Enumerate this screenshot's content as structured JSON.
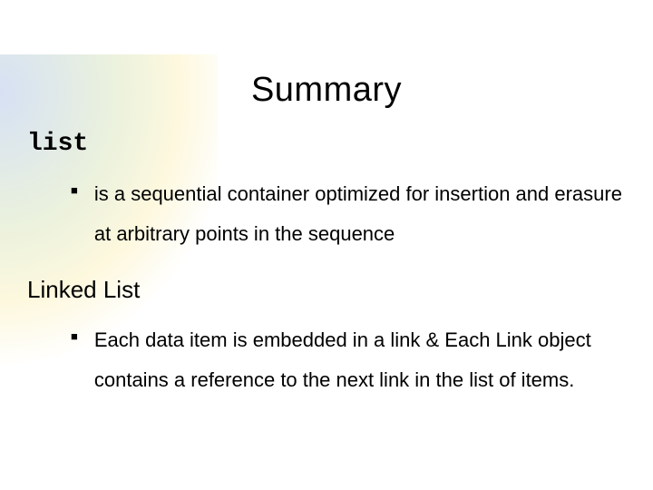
{
  "title": "Summary",
  "sections": [
    {
      "heading": "list",
      "heading_mono": true,
      "bullets": [
        "is a sequential container optimized for insertion and erasure at arbitrary points in the sequence"
      ]
    },
    {
      "heading": "Linked List",
      "heading_mono": false,
      "bullets": [
        "Each data item is embedded in a link & Each Link object contains a reference to the next link in the list of items."
      ]
    }
  ]
}
